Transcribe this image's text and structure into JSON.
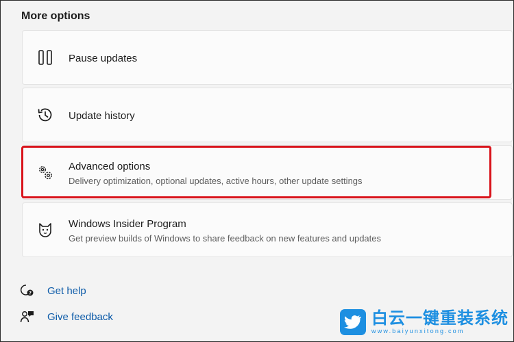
{
  "section": {
    "title": "More options"
  },
  "items": [
    {
      "label": "Pause updates",
      "description": "",
      "icon": "pause-icon"
    },
    {
      "label": "Update history",
      "description": "",
      "icon": "history-icon"
    },
    {
      "label": "Advanced options",
      "description": "Delivery optimization, optional updates, active hours, other update settings",
      "icon": "gears-icon"
    },
    {
      "label": "Windows Insider Program",
      "description": "Get preview builds of Windows to share feedback on new features and updates",
      "icon": "insider-cat-icon"
    }
  ],
  "links": [
    {
      "label": "Get help",
      "icon": "help-icon"
    },
    {
      "label": "Give feedback",
      "icon": "feedback-icon"
    }
  ],
  "watermark": {
    "name": "白云一键重装系统",
    "url": "www.baiyunxitong.com"
  },
  "colors": {
    "accent_link": "#0b5aa8",
    "highlight": "#d9131b",
    "watermark": "#1d8fe1"
  }
}
